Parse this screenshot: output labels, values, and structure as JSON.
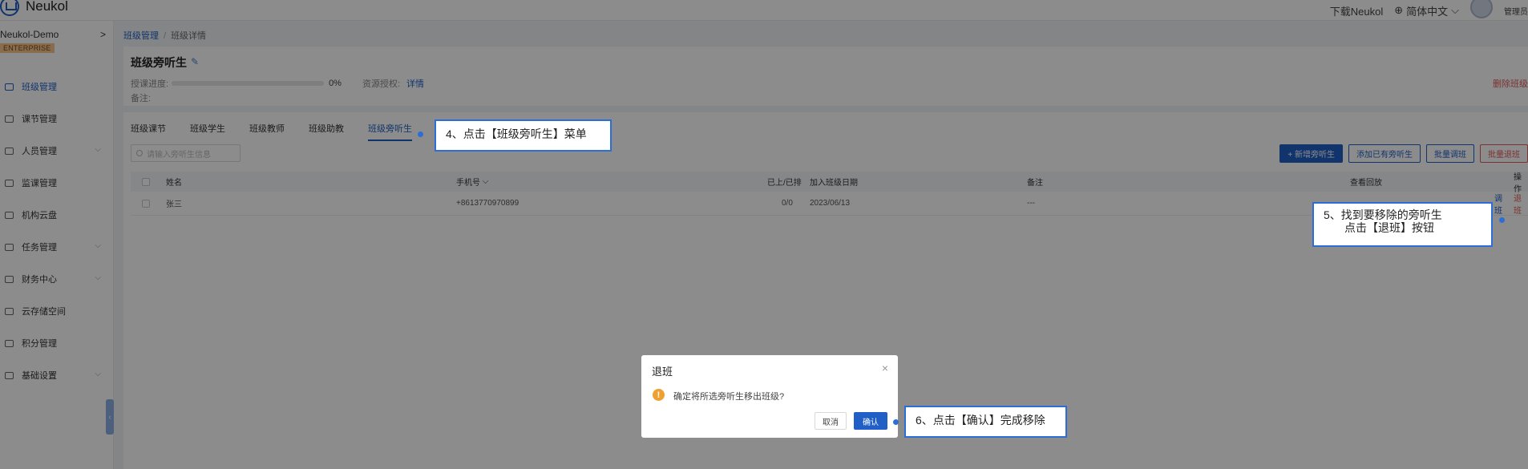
{
  "topbar": {
    "logo_text": "Neukol",
    "download": "下载Neukol",
    "language": "简体中文",
    "user": "管理员"
  },
  "sidebar": {
    "org_name": "Neukol-Demo",
    "badge": "ENTERPRISE",
    "items": [
      {
        "label": "班级管理",
        "icon": "class-icon",
        "active": true
      },
      {
        "label": "课节管理",
        "icon": "lesson-icon"
      },
      {
        "label": "人员管理",
        "icon": "people-icon",
        "expandable": true
      },
      {
        "label": "监课管理",
        "icon": "monitor-icon"
      },
      {
        "label": "机构云盘",
        "icon": "cloud-icon"
      },
      {
        "label": "任务管理",
        "icon": "task-icon",
        "expandable": true
      },
      {
        "label": "财务中心",
        "icon": "finance-icon",
        "expandable": true
      },
      {
        "label": "云存储空间",
        "icon": "storage-icon"
      },
      {
        "label": "积分管理",
        "icon": "points-icon"
      },
      {
        "label": "基础设置",
        "icon": "settings-icon",
        "expandable": true
      }
    ]
  },
  "breadcrumb": {
    "first": "班级管理",
    "second": "班级详情"
  },
  "class_card": {
    "title": "班级旁听生",
    "progress_label": "授课进度:",
    "progress_value": "0%",
    "progress": 0,
    "resource_label": "资源授权:",
    "resource_link": "详情",
    "memo_label": "备注:",
    "delete_label": "删除班级"
  },
  "tabs": [
    "班级课节",
    "班级学生",
    "班级教师",
    "班级助教",
    "班级旁听生"
  ],
  "active_tab": "班级旁听生",
  "search": {
    "placeholder": "请输入旁听生信息"
  },
  "actions": {
    "add": "+ 新增旁听生",
    "add_existing": "添加已有旁听生",
    "batch_transfer": "批量调班",
    "batch_exit": "批量退班"
  },
  "table": {
    "headers": {
      "name": "姓名",
      "phone": "手机号",
      "lessons": "已上/已排",
      "join_date": "加入班级日期",
      "remark": "备注",
      "replay": "查看回放",
      "ops": "操作"
    },
    "rows": [
      {
        "name": "张三",
        "phone": "+8613770970899",
        "lessons": "0/0",
        "join_date": "2023/06/13",
        "remark": "---",
        "op_transfer": "调班",
        "op_exit": "退班"
      }
    ]
  },
  "modal": {
    "title": "退班",
    "message": "确定将所选旁听生移出班级?",
    "cancel": "取消",
    "confirm": "确认"
  },
  "callouts": {
    "step4": "4、点击【班级旁听生】菜单",
    "step5_line1": "5、找到要移除的旁听生",
    "step5_line2": "点击【退班】按钮",
    "step6": "6、点击【确认】完成移除"
  },
  "colors": {
    "primary": "#1f5fc6",
    "danger": "#e05b5b",
    "callout_border": "#2b6fd6",
    "badge": "#f6c58e"
  }
}
